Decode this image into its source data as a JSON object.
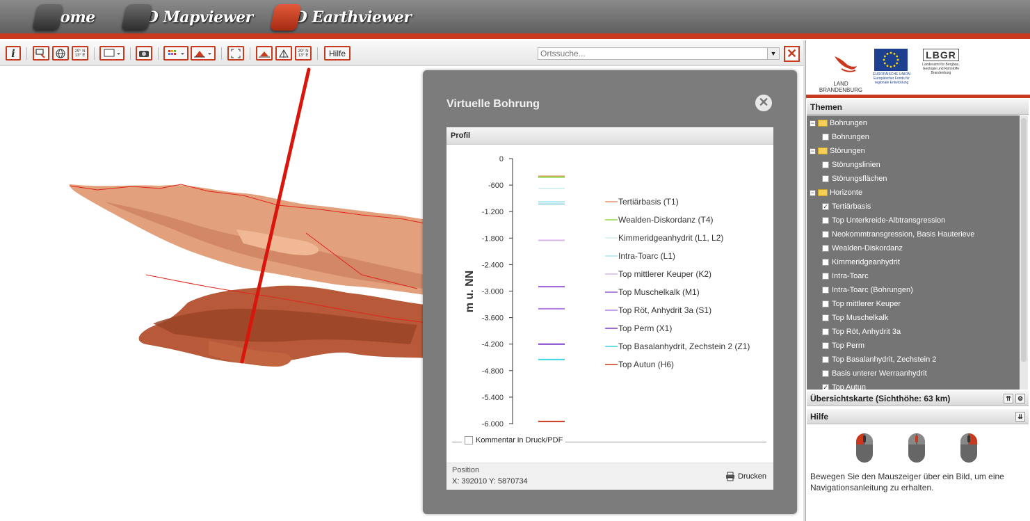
{
  "nav": {
    "tabs": [
      {
        "label": "Home",
        "active": false
      },
      {
        "label": "2D Mapviewer",
        "active": false
      },
      {
        "label": "3D Earthviewer",
        "active": true
      }
    ]
  },
  "toolbar": {
    "coord_glyph": "29° N\n13° E",
    "hilfe_label": "Hilfe",
    "search_placeholder": "Ortssuche..."
  },
  "dialog": {
    "title": "Virtuelle Bohrung",
    "panel_title": "Profil",
    "comment_label": "Kommentar in Druck/PDF",
    "position_label": "Position",
    "position_value": "X: 392010 Y: 5870734",
    "print_label": "Drucken"
  },
  "chart_data": {
    "type": "line",
    "ylabel": "m u. NN",
    "yticks": [
      "0",
      "-600",
      "-1.200",
      "-1.800",
      "-2.400",
      "-3.000",
      "-3.600",
      "-4.200",
      "-4.800",
      "-5.400",
      "-6.000"
    ],
    "ylim": [
      -6000,
      0
    ],
    "series": [
      {
        "name": "Tertiärbasis (T1)",
        "color": "#e8936a",
        "depth": -400
      },
      {
        "name": "Wealden-Diskordanz (T4)",
        "color": "#8ed94a",
        "depth": -420
      },
      {
        "name": "Kimmeridgeanhydrit (L1, L2)",
        "color": "#d0f0f0",
        "depth": -680
      },
      {
        "name": "Intra-Toarc (L1)",
        "color": "#a8e6f2",
        "depth": -980
      },
      {
        "name": "Top mittlerer Keuper (K2)",
        "color": "#d9b4ea",
        "depth": -1850
      },
      {
        "name": "Top Muschelkalk (M1)",
        "color": "#9b59d6",
        "depth": -2900
      },
      {
        "name": "Top Röt, Anhydrit 3a (S1)",
        "color": "#b37ee6",
        "depth": -3400
      },
      {
        "name": "Top Perm (X1)",
        "color": "#7a3fc9",
        "depth": -4200
      },
      {
        "name": "Top Basalanhydrit, Zechstein 2 (Z1)",
        "color": "#39d6e0",
        "depth": -4550
      },
      {
        "name": "Top Autun (H6)",
        "color": "#c8391e",
        "depth": -5950
      }
    ],
    "extra_lines": [
      {
        "color": "#9fd8e3",
        "depth": -1030
      }
    ]
  },
  "logos": {
    "brandenburg": "LAND\nBRANDENBURG",
    "eu_line1": "EUROPÄISCHE UNION",
    "eu_line2": "Europäischer Fonds für regionale Entwicklung",
    "lbgr": "LBGR",
    "lbgr_sub": "Landesamt für Bergbau, Geologie und Rohstoffe Brandenburg"
  },
  "themes": {
    "title": "Themen",
    "items": [
      {
        "label": "Bohrungen",
        "type": "folder"
      },
      {
        "label": "Bohrungen",
        "type": "layer",
        "checked": false
      },
      {
        "label": "Störungen",
        "type": "folder"
      },
      {
        "label": "Störungslinien",
        "type": "layer",
        "checked": false
      },
      {
        "label": "Störungsflächen",
        "type": "layer",
        "checked": false
      },
      {
        "label": "Horizonte",
        "type": "folder"
      },
      {
        "label": "Tertiärbasis",
        "type": "layer",
        "checked": true
      },
      {
        "label": "Top Unterkreide-Albtransgression",
        "type": "layer",
        "checked": false
      },
      {
        "label": "Neokommtransgression, Basis Hauterieve",
        "type": "layer",
        "checked": false
      },
      {
        "label": "Wealden-Diskordanz",
        "type": "layer",
        "checked": false
      },
      {
        "label": "Kimmeridgeanhydrit",
        "type": "layer",
        "checked": false
      },
      {
        "label": "Intra-Toarc",
        "type": "layer",
        "checked": false
      },
      {
        "label": "Intra-Toarc (Bohrungen)",
        "type": "layer",
        "checked": false
      },
      {
        "label": "Top mittlerer Keuper",
        "type": "layer",
        "checked": false
      },
      {
        "label": "Top Muschelkalk",
        "type": "layer",
        "checked": false
      },
      {
        "label": "Top Röt, Anhydrit 3a",
        "type": "layer",
        "checked": false
      },
      {
        "label": "Top Perm",
        "type": "layer",
        "checked": false
      },
      {
        "label": "Top Basalanhydrit, Zechstein 2",
        "type": "layer",
        "checked": false
      },
      {
        "label": "Basis unterer Werraanhydrit",
        "type": "layer",
        "checked": false
      },
      {
        "label": "Top Autun",
        "type": "layer",
        "checked": true
      }
    ]
  },
  "overview": {
    "title": "Übersichtskarte (Sichthöhe: 63 km)"
  },
  "help": {
    "title": "Hilfe",
    "text": "Bewegen Sie den Mauszeiger über ein Bild, um eine Navigationsanleitung zu erhalten."
  }
}
